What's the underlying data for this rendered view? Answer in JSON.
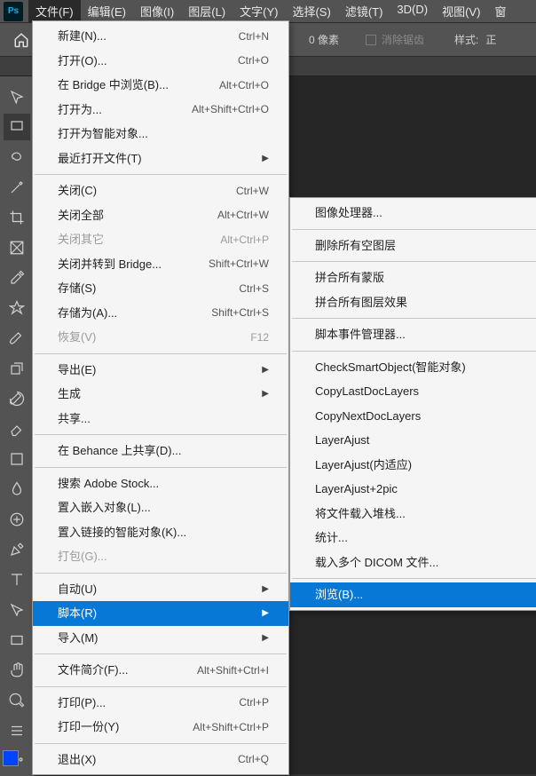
{
  "menubar": {
    "items": [
      "文件(F)",
      "编辑(E)",
      "图像(I)",
      "图层(L)",
      "文字(Y)",
      "选择(S)",
      "滤镜(T)",
      "3D(D)",
      "视图(V)",
      "窗"
    ]
  },
  "optionsbar": {
    "pixels_suffix": "0 像素",
    "antialias": "消除锯齿",
    "style_label": "样式:",
    "style_value": "正"
  },
  "file_menu": [
    {
      "label": "新建(N)...",
      "shortcut": "Ctrl+N"
    },
    {
      "label": "打开(O)...",
      "shortcut": "Ctrl+O"
    },
    {
      "label": "在 Bridge 中浏览(B)...",
      "shortcut": "Alt+Ctrl+O"
    },
    {
      "label": "打开为...",
      "shortcut": "Alt+Shift+Ctrl+O"
    },
    {
      "label": "打开为智能对象..."
    },
    {
      "label": "最近打开文件(T)",
      "submenu": true
    },
    {
      "sep": true
    },
    {
      "label": "关闭(C)",
      "shortcut": "Ctrl+W"
    },
    {
      "label": "关闭全部",
      "shortcut": "Alt+Ctrl+W"
    },
    {
      "label": "关闭其它",
      "shortcut": "Alt+Ctrl+P",
      "disabled": true
    },
    {
      "label": "关闭并转到 Bridge...",
      "shortcut": "Shift+Ctrl+W"
    },
    {
      "label": "存储(S)",
      "shortcut": "Ctrl+S"
    },
    {
      "label": "存储为(A)...",
      "shortcut": "Shift+Ctrl+S"
    },
    {
      "label": "恢复(V)",
      "shortcut": "F12",
      "disabled": true
    },
    {
      "sep": true
    },
    {
      "label": "导出(E)",
      "submenu": true
    },
    {
      "label": "生成",
      "submenu": true
    },
    {
      "label": "共享..."
    },
    {
      "sep": true
    },
    {
      "label": "在 Behance 上共享(D)..."
    },
    {
      "sep": true
    },
    {
      "label": "搜索 Adobe Stock..."
    },
    {
      "label": "置入嵌入对象(L)..."
    },
    {
      "label": "置入链接的智能对象(K)..."
    },
    {
      "label": "打包(G)...",
      "disabled": true
    },
    {
      "sep": true
    },
    {
      "label": "自动(U)",
      "submenu": true
    },
    {
      "label": "脚本(R)",
      "submenu": true,
      "highlighted": true
    },
    {
      "label": "导入(M)",
      "submenu": true
    },
    {
      "sep": true
    },
    {
      "label": "文件简介(F)...",
      "shortcut": "Alt+Shift+Ctrl+I"
    },
    {
      "sep": true
    },
    {
      "label": "打印(P)...",
      "shortcut": "Ctrl+P"
    },
    {
      "label": "打印一份(Y)",
      "shortcut": "Alt+Shift+Ctrl+P"
    },
    {
      "sep": true
    },
    {
      "label": "退出(X)",
      "shortcut": "Ctrl+Q"
    }
  ],
  "script_submenu": [
    {
      "label": "图像处理器..."
    },
    {
      "sep": true
    },
    {
      "label": "删除所有空图层"
    },
    {
      "sep": true
    },
    {
      "label": "拼合所有蒙版"
    },
    {
      "label": "拼合所有图层效果"
    },
    {
      "sep": true
    },
    {
      "label": "脚本事件管理器..."
    },
    {
      "sep": true
    },
    {
      "label": "CheckSmartObject(智能对象)"
    },
    {
      "label": "CopyLastDocLayers"
    },
    {
      "label": "CopyNextDocLayers"
    },
    {
      "label": "LayerAjust"
    },
    {
      "label": "LayerAjust(内适应)"
    },
    {
      "label": "LayerAjust+2pic"
    },
    {
      "label": "将文件载入堆栈..."
    },
    {
      "label": "统计..."
    },
    {
      "label": "载入多个 DICOM 文件..."
    },
    {
      "sep": true
    },
    {
      "label": "浏览(B)...",
      "highlighted": true
    }
  ],
  "tools": [
    "move",
    "marquee",
    "lasso",
    "magic-wand",
    "crop",
    "frame",
    "eyedropper",
    "healing",
    "brush",
    "clone",
    "history-brush",
    "eraser",
    "gradient",
    "blur",
    "dodge",
    "pen",
    "type",
    "path-select",
    "rectangle",
    "hand",
    "zoom",
    "edit-toolbar",
    "ellipsis"
  ]
}
